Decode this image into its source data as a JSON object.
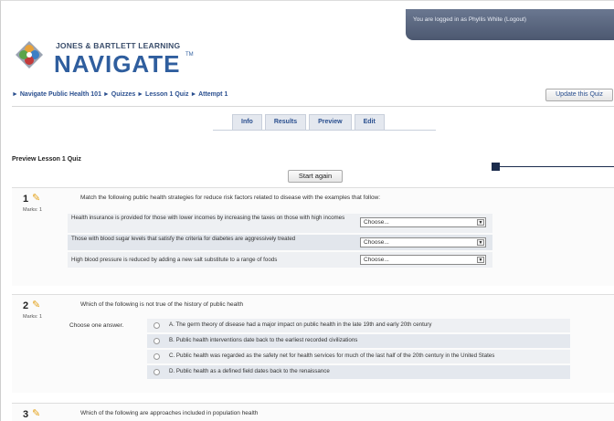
{
  "header": {
    "login_text": "You are logged in as Phyllis White (Logout)",
    "logo_top": "JONES & BARTLETT LEARNING",
    "logo_main": "NAVIGATE",
    "logo_tm": "TM"
  },
  "breadcrumb": "► Navigate Public Health 101 ► Quizzes ► Lesson 1 Quiz ► Attempt 1",
  "update_button": "Update this Quiz",
  "tabs": [
    {
      "label": "Info"
    },
    {
      "label": "Results"
    },
    {
      "label": "Preview"
    },
    {
      "label": "Edit"
    }
  ],
  "preview_title": "Preview Lesson 1 Quiz",
  "start_again": "Start again",
  "questions": [
    {
      "number": "1",
      "marks": "Marks: 1",
      "text": "Match the following public health strategies for reduce risk factors related to disease with the examples that follow:",
      "rows": [
        {
          "text": "Health insurance is provided for those with lower incomes by increasing the taxes on those with high incomes",
          "select": "Choose..."
        },
        {
          "text": "Those with blood sugar levels that satisfy the criteria for diabetes are aggressively treated",
          "select": "Choose..."
        },
        {
          "text": "High blood pressure is reduced by adding a new salt substitute to a range of foods",
          "select": "Choose..."
        }
      ]
    },
    {
      "number": "2",
      "marks": "Marks: 1",
      "text": "Which of the following is not true of the history of public health",
      "choose_label": "Choose one answer.",
      "options": [
        {
          "text": "A. The germ theory of disease had a major impact on public health in the late 19th and early 20th century"
        },
        {
          "text": "B. Public health interventions date back to the earliest recorded civilizations"
        },
        {
          "text": "C. Public health was regarded as the safety net for health services for much of the last half of the 20th century in the United States"
        },
        {
          "text": "D. Public health as a defined field dates back to the renaissance"
        }
      ]
    },
    {
      "number": "3",
      "text": "Which of the following are approaches included in population health"
    }
  ],
  "colors": {
    "brand_blue": "#2f5e9e",
    "link_blue": "#2a4f8f",
    "header_bar": "#55617a",
    "pencil": "#e3a21a"
  }
}
